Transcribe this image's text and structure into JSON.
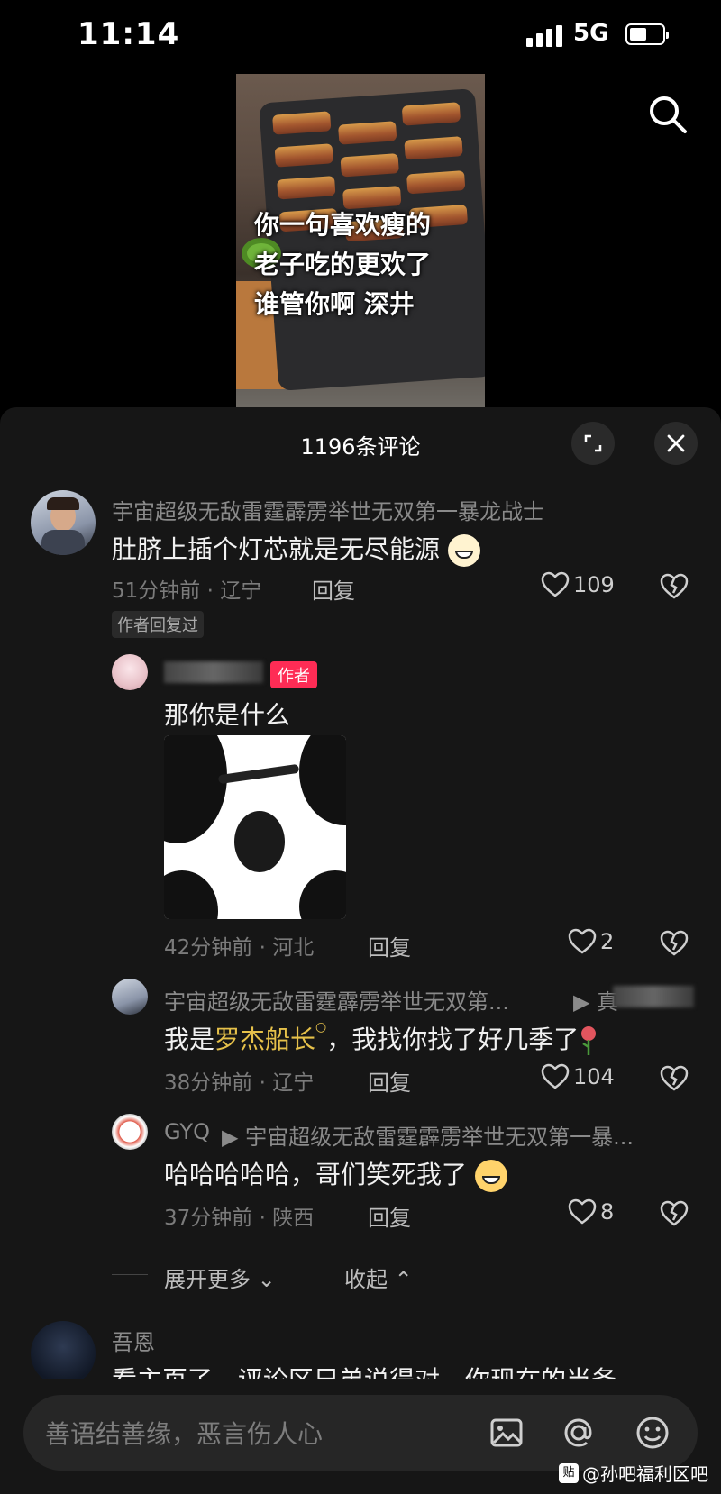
{
  "status_bar": {
    "time": "11:14",
    "network": "5G"
  },
  "video": {
    "caption_lines": [
      "你一句喜欢瘦的",
      "老子吃的更欢了",
      "谁管你啊 深井"
    ]
  },
  "comments_panel": {
    "title": "1196条评论"
  },
  "comments": [
    {
      "user": "宇宙超级无敌雷霆霹雳举世无双第一暴龙战士",
      "text": "肚脐上插个灯芯就是无尽能源",
      "time_location": "51分钟前 · 辽宁",
      "reply_label": "回复",
      "likes": "109",
      "badge": "作者回复过",
      "replies": [
        {
          "author_tag": "作者",
          "text": "那你是什么",
          "time_location": "42分钟前 · 河北",
          "reply_label": "回复",
          "likes": "2"
        },
        {
          "user": "宇宙超级无敌雷霆霹雳举世无双第...",
          "reply_to_prefix": "▶ 真",
          "text_prefix": "我是",
          "text_link": "罗杰船长",
          "text_suffix": "，我找你找了好几季了",
          "time_location": "38分钟前 · 辽宁",
          "reply_label": "回复",
          "likes": "104"
        },
        {
          "user": "GYQ",
          "reply_to": "▶ 宇宙超级无敌雷霆霹雳举世无双第一暴...",
          "text": "哈哈哈哈哈，哥们笑死我了",
          "time_location": "37分钟前 · 陕西",
          "reply_label": "回复",
          "likes": "8"
        }
      ],
      "expand_more": "展开更多",
      "collapse": "收起"
    },
    {
      "user": "吾恩",
      "text": "看主页了，评论区兄弟说得对，你现在的当务"
    }
  ],
  "input": {
    "placeholder": "善语结善缘，恶言伤人心"
  },
  "watermark": {
    "icon_label": "贴",
    "text": "@孙吧福利区吧"
  }
}
